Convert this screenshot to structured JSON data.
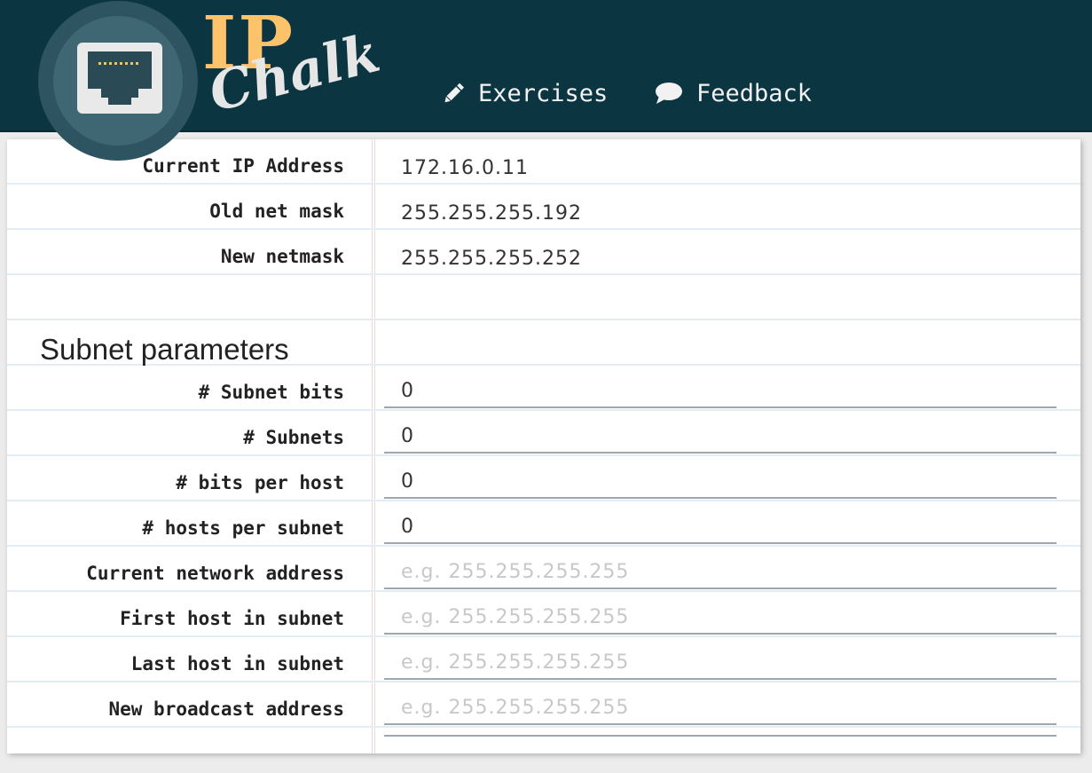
{
  "logo": {
    "ip": "IP",
    "chalk": "Chalk"
  },
  "nav": {
    "exercises": "Exercises",
    "feedback": "Feedback"
  },
  "given": [
    {
      "label": "Current IP Address",
      "value": "172.16.0.11"
    },
    {
      "label": "Old net mask",
      "value": "255.255.255.192"
    },
    {
      "label": "New netmask",
      "value": "255.255.255.252"
    }
  ],
  "section_title": "Subnet parameters",
  "fields": [
    {
      "label": "# Subnet bits",
      "value": "0",
      "placeholder": ""
    },
    {
      "label": "# Subnets",
      "value": "0",
      "placeholder": ""
    },
    {
      "label": "# bits per host",
      "value": "0",
      "placeholder": ""
    },
    {
      "label": "# hosts per subnet",
      "value": "0",
      "placeholder": ""
    },
    {
      "label": "Current network address",
      "value": "",
      "placeholder": "e.g. 255.255.255.255"
    },
    {
      "label": "First host in subnet",
      "value": "",
      "placeholder": "e.g. 255.255.255.255"
    },
    {
      "label": "Last host in subnet",
      "value": "",
      "placeholder": "e.g. 255.255.255.255"
    },
    {
      "label": "New broadcast address",
      "value": "",
      "placeholder": "e.g. 255.255.255.255"
    }
  ],
  "colors": {
    "header_bg": "#0c3542",
    "logo_ip": "#fcc36b",
    "logo_chalk": "#e6e6e6"
  }
}
